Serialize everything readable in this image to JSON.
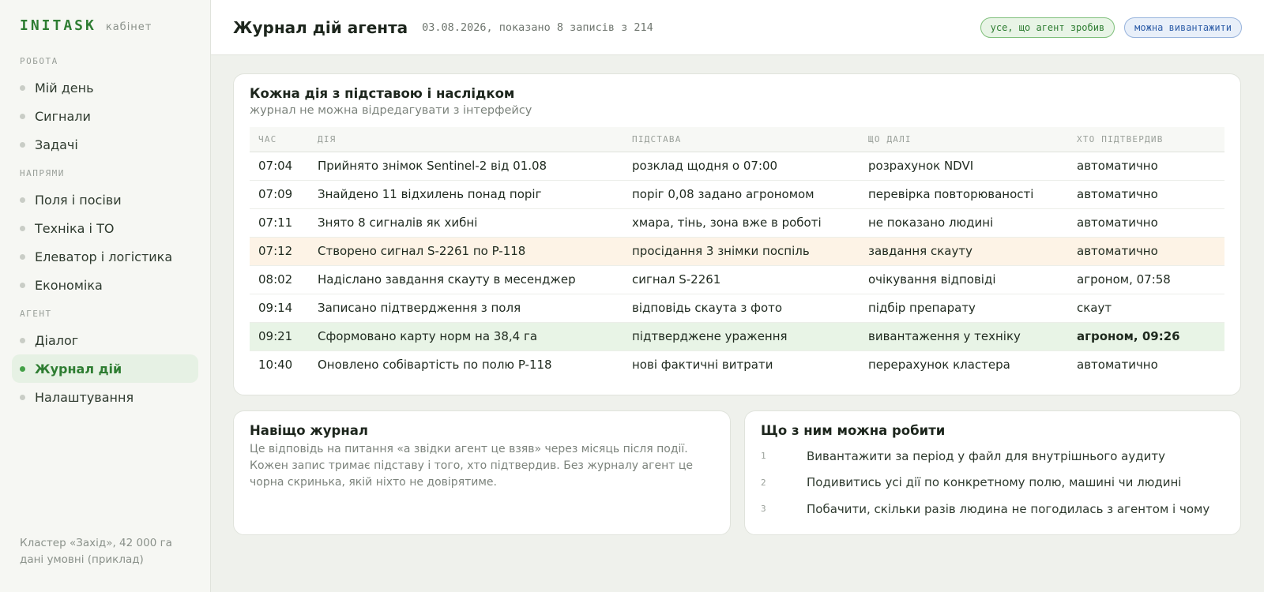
{
  "brand": {
    "logo": "INITASK",
    "sub": "кабінет"
  },
  "sidebar": {
    "groups": [
      {
        "label": "РОБОТА",
        "items": [
          "Мій день",
          "Сигнали",
          "Задачі"
        ]
      },
      {
        "label": "НАПРЯМИ",
        "items": [
          "Поля і посіви",
          "Техніка і ТО",
          "Елеватор і логістика",
          "Економіка"
        ]
      },
      {
        "label": "АГЕНТ",
        "items": [
          "Діалог",
          "Журнал дій",
          "Налаштування"
        ]
      }
    ],
    "active_item": "Журнал дій",
    "footer_line1": "Кластер «Захід», 42 000 га",
    "footer_line2": "дані умовні (приклад)"
  },
  "header": {
    "title": "Журнал дій агента",
    "meta": "03.08.2026, показано 8 записів з 214",
    "pill_green": "усе, що агент зробив",
    "pill_blue": "можна вивантажити"
  },
  "log": {
    "title": "Кожна дія з підставою і наслідком",
    "subtitle": "журнал не можна відредагувати з інтерфейсу",
    "columns": [
      "ЧАС",
      "ДІЯ",
      "ПІДСТАВА",
      "ЩО ДАЛІ",
      "ХТО ПІДТВЕРДИВ"
    ],
    "rows": [
      [
        "07:04",
        "Прийнято знімок Sentinel-2 від 01.08",
        "розклад щодня о 07:00",
        "розрахунок NDVI",
        "автоматично"
      ],
      [
        "07:09",
        "Знайдено 11 відхилень понад поріг",
        "поріг 0,08 задано агрономом",
        "перевірка повторюваності",
        "автоматично"
      ],
      [
        "07:11",
        "Знято 8 сигналів як хибні",
        "хмара, тінь, зона вже в роботі",
        "не показано людині",
        "автоматично"
      ],
      [
        "07:12",
        "Створено сигнал S-2261 по P-118",
        "просідання 3 знімки поспіль",
        "завдання скауту",
        "автоматично"
      ],
      [
        "08:02",
        "Надіслано завдання скауту в месенджер",
        "сигнал S-2261",
        "очікування відповіді",
        "агроном, 07:58"
      ],
      [
        "09:14",
        "Записано підтвердження з поля",
        "відповідь скаута з фото",
        "підбір препарату",
        "скаут"
      ],
      [
        "09:21",
        "Сформовано карту норм на 38,4 га",
        "підтверджене ураження",
        "вивантаження у техніку",
        "агроном, 09:26"
      ],
      [
        "10:40",
        "Оновлено собівартість по полю P-118",
        "нові фактичні витрати",
        "перерахунок кластера",
        "автоматично"
      ]
    ]
  },
  "why": {
    "title": "Навіщо журнал",
    "line1": "Це відповідь на питання «а звідки агент це взяв» через місяць після події.",
    "line2": "Кожен запис тримає підставу і того, хто підтвердив. Без журналу агент це",
    "line3": "чорна скринька, якій ніхто не довірятиме."
  },
  "actions": {
    "title": "Що з ним можна робити",
    "items": [
      {
        "num": "1",
        "text": "Вивантажити за період у файл для внутрішнього аудиту"
      },
      {
        "num": "2",
        "text": "Подивитись усі дії по конкретному полю, машині чи людині"
      },
      {
        "num": "3",
        "text": "Побачити, скільки разів людина не погодилась з агентом і чому"
      }
    ]
  },
  "colors": {
    "accent": "#2e7d32",
    "highlight_warn": "#fdf3e6",
    "highlight_ok": "#e8f4e6",
    "pill_blue": "#2f5ea8"
  }
}
